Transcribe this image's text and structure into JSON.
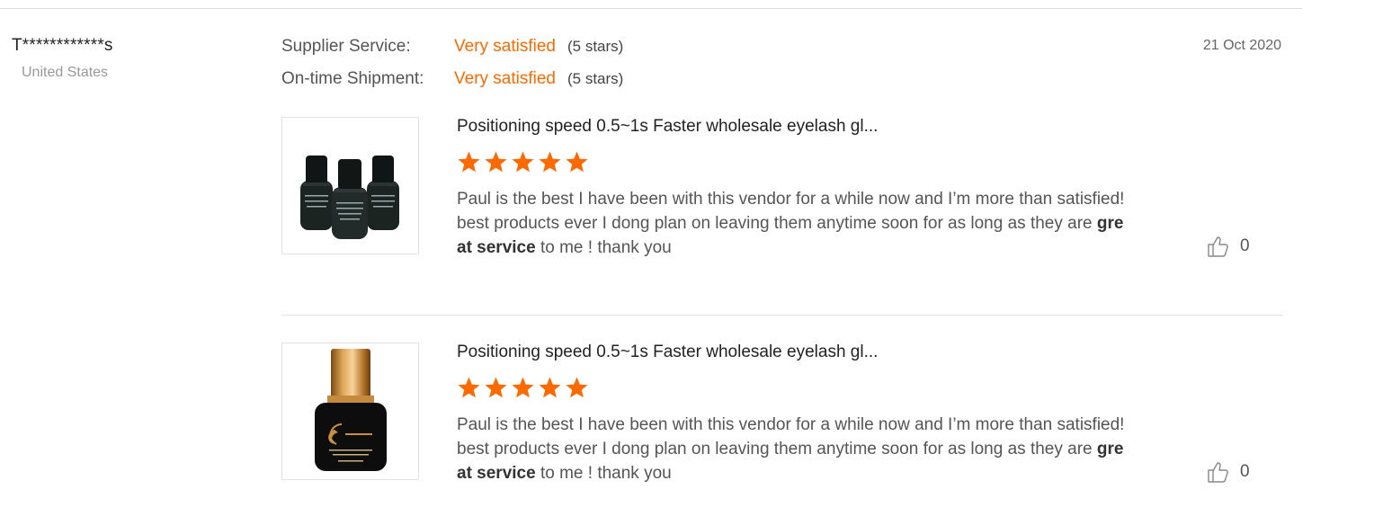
{
  "reviewer": {
    "name": "T************s",
    "country": "United States"
  },
  "date": "21 Oct 2020",
  "ratings": [
    {
      "label": "Supplier Service:",
      "value": "Very satisfied",
      "stars_text": "(5 stars)"
    },
    {
      "label": "On-time Shipment:",
      "value": "Very satisfied",
      "stars_text": "(5 stars)"
    }
  ],
  "products": [
    {
      "title": "Positioning speed 0.5~1s Faster wholesale eyelash gl...",
      "rating": 5,
      "review_before": "Paul is the best I have been with this vendor for a while now and I’m more than satisfied! best products ever I dong plan on leaving them anytime soon for as long as they are ",
      "review_bold": "great service",
      "review_after": " to me ! thank you",
      "likes": "0",
      "image_icon": "three-black-glue-bottles"
    },
    {
      "title": "Positioning speed 0.5~1s Faster wholesale eyelash gl...",
      "rating": 5,
      "review_before": "Paul is the best I have been with this vendor for a while now and I’m more than satisfied! best products ever I dong plan on leaving them anytime soon for as long as they are ",
      "review_bold": "great service",
      "review_after": " to me ! thank you",
      "likes": "0",
      "image_icon": "gold-cap-glue-bottle"
    }
  ],
  "colors": {
    "accent": "#ff6a00",
    "star": "#ff6a00",
    "divider": "#e2e2e2"
  }
}
